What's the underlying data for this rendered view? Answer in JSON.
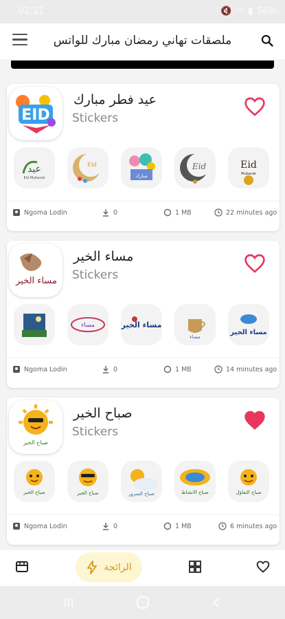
{
  "status": {
    "time": "02:21",
    "battery": "56%"
  },
  "app_bar": {
    "title": "ملصقات تهاني رمضان مبارك للواتس"
  },
  "packs": [
    {
      "title": "عيد فطر مبارك",
      "subtitle": "Stickers",
      "favorited": false,
      "author": "Ngoma Lodin",
      "downloads": "0",
      "size": "1 MB",
      "time_ago": "22 minutes ago"
    },
    {
      "title": "مساء الخير",
      "subtitle": "Stickers",
      "favorited": false,
      "author": "Ngoma Lodin",
      "downloads": "0",
      "size": "1 MB",
      "time_ago": "14 minutes ago"
    },
    {
      "title": "صباح الخير",
      "subtitle": "Stickers",
      "favorited": true,
      "author": "Ngoma Lodin",
      "downloads": "0",
      "size": "1 MB",
      "time_ago": "6 minutes ago"
    }
  ],
  "bottom_nav": {
    "active_label": "الرائجة"
  },
  "colors": {
    "heart": "#e8365d",
    "accent": "#d29a1b",
    "pill": "#fdf6d2"
  },
  "icons": [
    "menu-icon",
    "search-icon",
    "heart-icon",
    "author-icon",
    "download-icon",
    "size-icon",
    "clock-icon",
    "store-icon",
    "bolt-icon",
    "grid-icon"
  ]
}
